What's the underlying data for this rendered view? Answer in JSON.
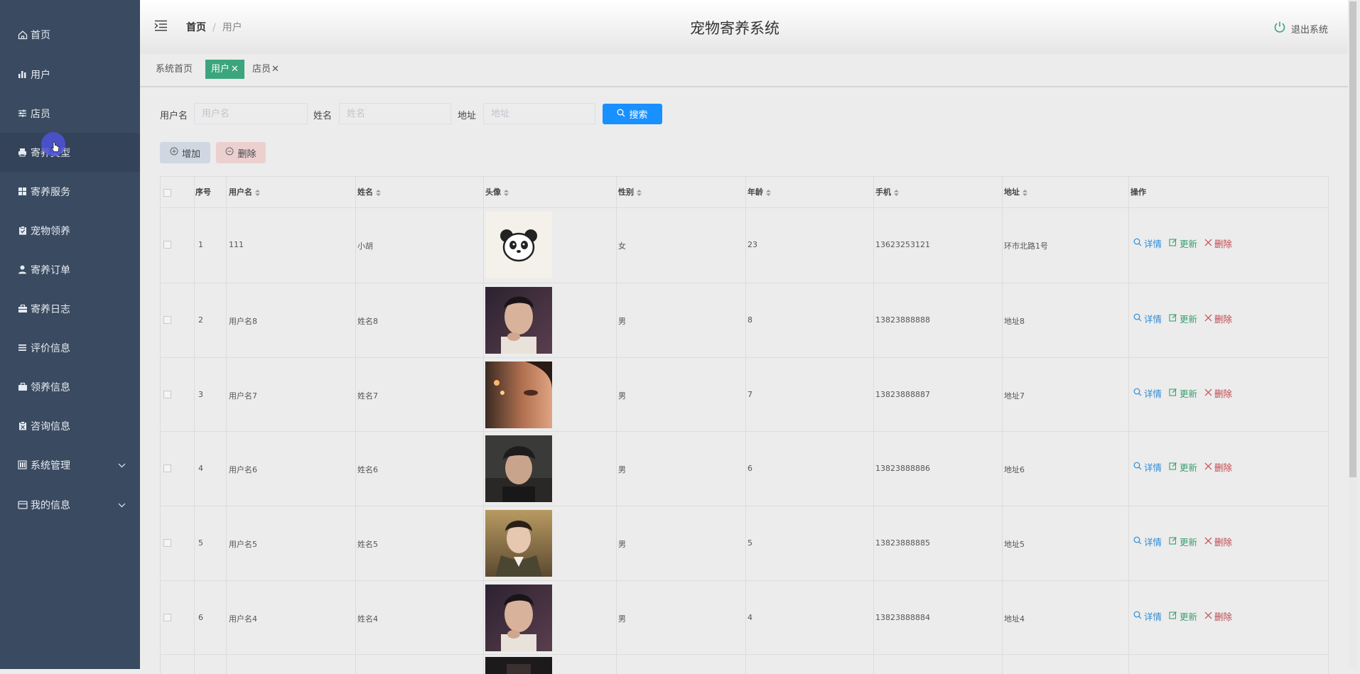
{
  "sidebar": {
    "items": [
      {
        "label": "首页",
        "icon": "home-icon"
      },
      {
        "label": "用户",
        "icon": "bar-chart-icon"
      },
      {
        "label": "店员",
        "icon": "sliders-icon"
      },
      {
        "label": "寄养类型",
        "icon": "printer-icon"
      },
      {
        "label": "寄养服务",
        "icon": "grid-icon"
      },
      {
        "label": "宠物领养",
        "icon": "clipboard-icon"
      },
      {
        "label": "寄养订单",
        "icon": "user-icon"
      },
      {
        "label": "寄养日志",
        "icon": "briefcase-icon"
      },
      {
        "label": "评价信息",
        "icon": "list-icon"
      },
      {
        "label": "领养信息",
        "icon": "suitcase-icon"
      },
      {
        "label": "咨询信息",
        "icon": "clipboard-check-icon"
      },
      {
        "label": "系统管理",
        "icon": "columns-icon"
      },
      {
        "label": "我的信息",
        "icon": "card-icon"
      }
    ]
  },
  "header": {
    "breadcrumb": [
      "首页",
      "用户"
    ],
    "title": "宠物寄养系统",
    "logout": "退出系统"
  },
  "tabs": [
    {
      "label": "系统首页",
      "closable": false
    },
    {
      "label": "用户",
      "closable": true
    },
    {
      "label": "店员",
      "closable": true
    }
  ],
  "search": {
    "username_label": "用户名",
    "username_placeholder": "用户名",
    "name_label": "姓名",
    "name_placeholder": "姓名",
    "address_label": "地址",
    "address_placeholder": "地址",
    "button": "搜索"
  },
  "actions": {
    "add": "增加",
    "delete": "删除"
  },
  "table": {
    "columns": [
      "序号",
      "用户名",
      "姓名",
      "头像",
      "性别",
      "年龄",
      "手机",
      "地址",
      "操作"
    ],
    "ops": {
      "detail": "详情",
      "update": "更新",
      "delete": "删除"
    },
    "rows": [
      {
        "no": "1",
        "username": "111",
        "name": "小胡",
        "avatar": "panda",
        "gender": "女",
        "age": "23",
        "phone": "13623253121",
        "address": "环市北路1号"
      },
      {
        "no": "2",
        "username": "用户名8",
        "name": "姓名8",
        "avatar": "photo-1",
        "gender": "男",
        "age": "8",
        "phone": "13823888888",
        "address": "地址8"
      },
      {
        "no": "3",
        "username": "用户名7",
        "name": "姓名7",
        "avatar": "photo-2",
        "gender": "男",
        "age": "7",
        "phone": "13823888887",
        "address": "地址7"
      },
      {
        "no": "4",
        "username": "用户名6",
        "name": "姓名6",
        "avatar": "photo-3",
        "gender": "男",
        "age": "6",
        "phone": "13823888886",
        "address": "地址6"
      },
      {
        "no": "5",
        "username": "用户名5",
        "name": "姓名5",
        "avatar": "photo-4",
        "gender": "男",
        "age": "5",
        "phone": "13823888885",
        "address": "地址5"
      },
      {
        "no": "6",
        "username": "用户名4",
        "name": "姓名4",
        "avatar": "photo-1",
        "gender": "男",
        "age": "4",
        "phone": "13823888884",
        "address": "地址4"
      }
    ]
  },
  "colors": {
    "sidebar": "#3a4a60",
    "tab_active": "#3ba57d",
    "search_button": "#1890ff",
    "detail": "#2e8cd6",
    "update": "#3a9f6f",
    "delete": "#c0464b"
  }
}
